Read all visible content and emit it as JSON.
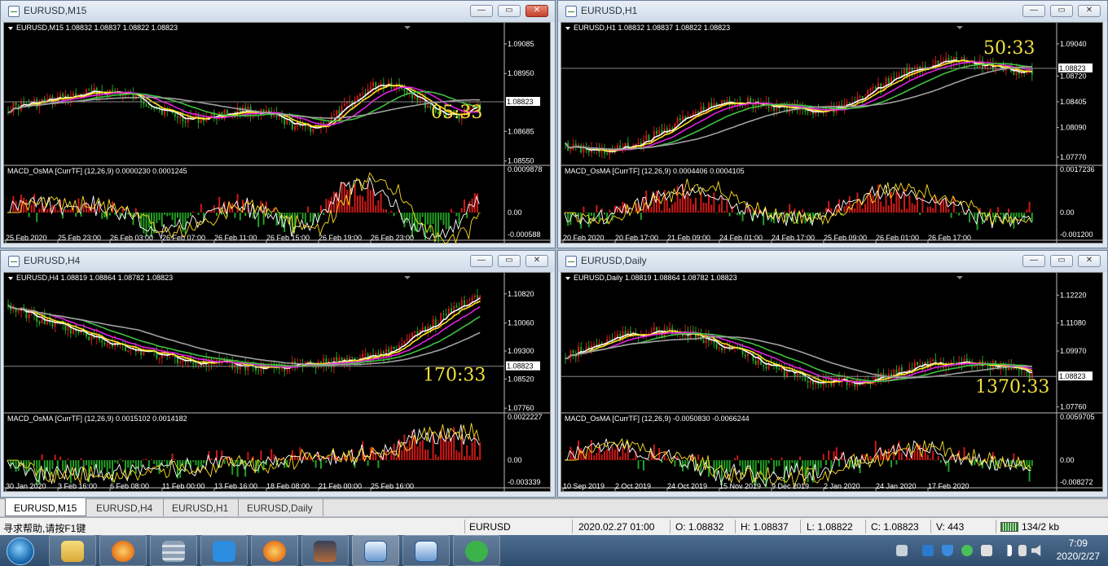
{
  "windows": [
    {
      "title": "EURUSD,M15",
      "info": "EURUSD,M15  1.08832 1.08837 1.08822 1.08823",
      "price_labels": [
        "1.09085",
        "1.08950",
        "1.08823",
        "1.08685",
        "1.08550"
      ],
      "current_price": "1.08823",
      "countdown": "05:33",
      "macd_label": "MACD_OsMA [CurrTF] (12,26,9) 0.0000230 0.0001245",
      "macd_labels": [
        "0.0009878",
        "0.00",
        "-0.000588"
      ],
      "time_labels": [
        "25 Feb 2020",
        "25 Feb 23:00",
        "26 Feb 03:00",
        "26 Feb 07:00",
        "26 Feb 11:00",
        "26 Feb 15:00",
        "26 Feb 19:00",
        "26 Feb 23:00"
      ],
      "active": true
    },
    {
      "title": "EURUSD,H1",
      "info": "EURUSD,H1  1.08832 1.08837 1.08822 1.08823",
      "price_labels": [
        "1.09040",
        "1.08823",
        "1.08720",
        "1.08405",
        "1.08090",
        "1.07770"
      ],
      "current_price": "1.08823",
      "countdown": "50:33",
      "macd_label": "MACD_OsMA [CurrTF] (12,26,9) 0.0004406 0.0004105",
      "macd_labels": [
        "0.0017236",
        "0.00",
        "-0.001200"
      ],
      "time_labels": [
        "20 Feb 2020",
        "20 Feb 17:00",
        "21 Feb 09:00",
        "24 Feb 01:00",
        "24 Feb 17:00",
        "25 Feb 09:00",
        "26 Feb 01:00",
        "26 Feb 17:00"
      ],
      "active": false
    },
    {
      "title": "EURUSD,H4",
      "info": "EURUSD,H4  1.08819 1.08864 1.08782 1.08823",
      "price_labels": [
        "1.10820",
        "1.10060",
        "1.09300",
        "1.08823",
        "1.08520",
        "1.07760"
      ],
      "current_price": "1.08823",
      "countdown": "170:33",
      "macd_label": "MACD_OsMA [CurrTF] (12,26,9) 0.0015102 0.0014182",
      "macd_labels": [
        "0.0022227",
        "0.00",
        "-0.003339"
      ],
      "time_labels": [
        "30 Jan 2020",
        "3 Feb 16:00",
        "6 Feb 08:00",
        "11 Feb 00:00",
        "13 Feb 16:00",
        "18 Feb 08:00",
        "21 Feb 00:00",
        "25 Feb 16:00"
      ],
      "active": false
    },
    {
      "title": "EURUSD,Daily",
      "info": "EURUSD,Daily  1.08819 1.08864 1.08782 1.08823",
      "price_labels": [
        "1.12220",
        "1.11080",
        "1.09970",
        "1.08823",
        "1.07760"
      ],
      "current_price": "1.08823",
      "countdown": "1370:33",
      "macd_label": "MACD_OsMA [CurrTF] (12,26,9) -0.0050830 -0.0066244",
      "macd_labels": [
        "0.0059705",
        "0.00",
        "-0.008272"
      ],
      "time_labels": [
        "10 Sep 2019",
        "2 Oct 2019",
        "24 Oct 2019",
        "15 Nov 2019",
        "9 Dec 2019",
        "2 Jan 2020",
        "24 Jan 2020",
        "17 Feb 2020"
      ],
      "active": false
    }
  ],
  "tabs": [
    "EURUSD,M15",
    "EURUSD,H4",
    "EURUSD,H1",
    "EURUSD,Daily"
  ],
  "status": {
    "help": "寻求帮助,请按F1键",
    "symbol": "EURUSD",
    "datetime": "2020.02.27 01:00",
    "open": "O: 1.08832",
    "high": "H: 1.08837",
    "low": "L: 1.08822",
    "close": "C: 1.08823",
    "volume": "V: 443",
    "traffic": "134/2 kb"
  },
  "clock": {
    "time": "7:09",
    "date": "2020/2/27"
  },
  "colors": {
    "bull": "#d01818",
    "bear": "#22a022",
    "ma_white": "#ffffff",
    "ma_yellow": "#ffe020",
    "ma_magenta": "#e020e0",
    "ma_green": "#40c040",
    "ma_gray": "#a0a0a0",
    "countdown": "#f0e040"
  },
  "taskbar_icons": [
    "start-orb-icon",
    "explorer-icon",
    "browser-icon",
    "calculator-icon",
    "notes-icon",
    "browser-icon-2",
    "game-icon",
    "terminal-icon-1",
    "terminal-icon-2",
    "wechat-icon"
  ]
}
